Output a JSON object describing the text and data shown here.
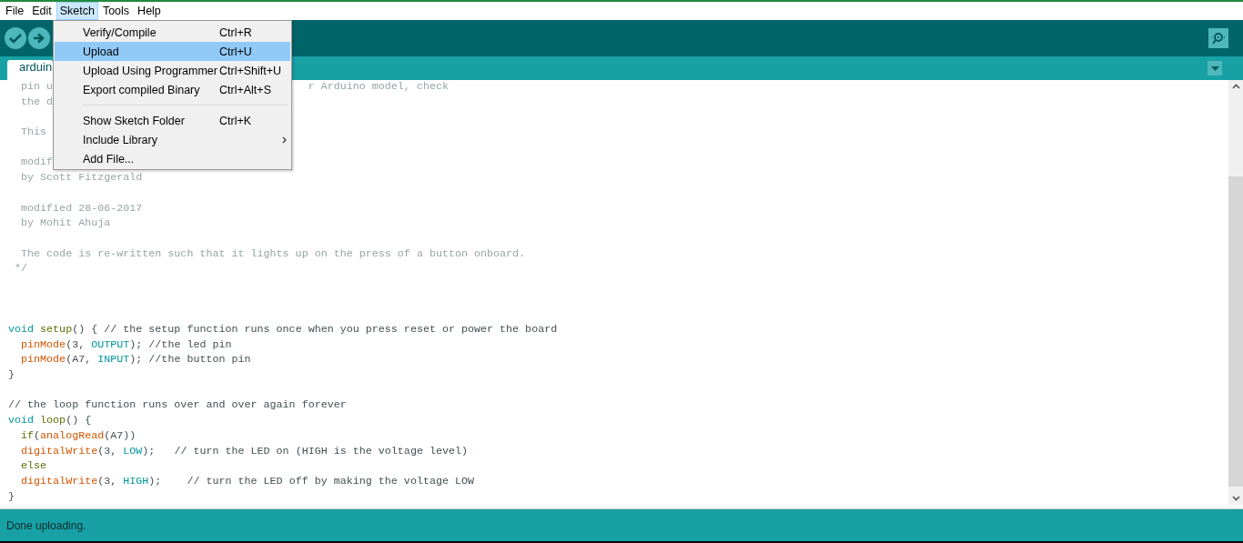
{
  "menu_bar": [
    {
      "label": "File",
      "selected": false
    },
    {
      "label": "Edit",
      "selected": false
    },
    {
      "label": "Sketch",
      "selected": true
    },
    {
      "label": "Tools",
      "selected": false
    },
    {
      "label": "Help",
      "selected": false
    }
  ],
  "toolbar": {
    "buttons": [
      {
        "kind": "verify"
      },
      {
        "kind": "upload"
      }
    ],
    "right_buttons": [
      {
        "kind": "serial-monitor"
      }
    ]
  },
  "tabs": [
    {
      "label": "arduin",
      "selected": true
    }
  ],
  "editor": {
    "lines": [
      {
        "kind": "code",
        "segments": [
          [
            {
              "kind": "comment",
              "text": "  pin u"
            }
          ],
          [
            {
              "kind": "comment",
              "text": "                                        r Arduino model, check"
            }
          ]
        ]
      },
      {
        "kind": "code",
        "segments": [
          [
            {
              "kind": "comment",
              "text": "  the d"
            }
          ]
        ]
      },
      {
        "kind": "blank"
      },
      {
        "kind": "code",
        "segments": [
          [
            {
              "kind": "comment",
              "text": "  This"
            }
          ]
        ]
      },
      {
        "kind": "blank"
      },
      {
        "kind": "code",
        "segments": [
          [
            {
              "kind": "comment",
              "text": "  modif"
            }
          ]
        ]
      },
      {
        "kind": "code",
        "segments": [
          [
            {
              "kind": "comment",
              "text": "  by Scott Fitzgerald"
            }
          ]
        ]
      },
      {
        "kind": "blank"
      },
      {
        "kind": "code",
        "segments": [
          [
            {
              "kind": "comment",
              "text": "  modified 28-06-2017"
            }
          ]
        ]
      },
      {
        "kind": "code",
        "segments": [
          [
            {
              "kind": "comment",
              "text": "  by Mohit Ahuja"
            }
          ]
        ]
      },
      {
        "kind": "blank"
      },
      {
        "kind": "code",
        "segments": [
          [
            {
              "kind": "comment",
              "text": "  The code is re-written such that it lights up on the press of a button onboard."
            }
          ]
        ]
      },
      {
        "kind": "code",
        "segments": [
          [
            {
              "kind": "comment",
              "text": " */"
            }
          ]
        ]
      },
      {
        "kind": "blank"
      },
      {
        "kind": "blank"
      },
      {
        "kind": "blank"
      },
      {
        "kind": "code",
        "segments": [
          [
            {
              "kind": "type",
              "text": "void "
            },
            {
              "kind": "function",
              "text": "setup"
            },
            {
              "kind": "plain",
              "text": "() { // the setup function runs once when you press reset or power the board"
            }
          ]
        ]
      },
      {
        "kind": "code",
        "segments": [
          [
            {
              "kind": "builtin",
              "text": "  pinMode"
            },
            {
              "kind": "plain",
              "text": "(3, "
            },
            {
              "kind": "constant",
              "text": "OUTPUT"
            },
            {
              "kind": "plain",
              "text": "); //the led pin"
            }
          ]
        ]
      },
      {
        "kind": "code",
        "segments": [
          [
            {
              "kind": "builtin",
              "text": "  pinMode"
            },
            {
              "kind": "plain",
              "text": "(A7, "
            },
            {
              "kind": "constant",
              "text": "INPUT"
            },
            {
              "kind": "plain",
              "text": "); //the button pin"
            }
          ]
        ]
      },
      {
        "kind": "code",
        "segments": [
          [
            {
              "kind": "plain",
              "text": "}"
            }
          ]
        ]
      },
      {
        "kind": "blank"
      },
      {
        "kind": "code",
        "segments": [
          [
            {
              "kind": "plain",
              "text": "// the loop function runs over and over again forever"
            }
          ]
        ]
      },
      {
        "kind": "code",
        "segments": [
          [
            {
              "kind": "type",
              "text": "void "
            },
            {
              "kind": "function",
              "text": "loop"
            },
            {
              "kind": "plain",
              "text": "() {"
            }
          ]
        ]
      },
      {
        "kind": "code",
        "segments": [
          [
            {
              "kind": "function",
              "text": "  if"
            },
            {
              "kind": "plain",
              "text": "("
            },
            {
              "kind": "builtin",
              "text": "analogRead"
            },
            {
              "kind": "plain",
              "text": "(A7))"
            }
          ]
        ]
      },
      {
        "kind": "code",
        "segments": [
          [
            {
              "kind": "builtin",
              "text": "  digitalWrite"
            },
            {
              "kind": "plain",
              "text": "(3, "
            },
            {
              "kind": "constant",
              "text": "LOW"
            },
            {
              "kind": "plain",
              "text": ");   // turn the LED on (HIGH is the voltage level)"
            }
          ]
        ]
      },
      {
        "kind": "code",
        "segments": [
          [
            {
              "kind": "function",
              "text": "  else"
            }
          ]
        ]
      },
      {
        "kind": "code",
        "segments": [
          [
            {
              "kind": "builtin",
              "text": "  digitalWrite"
            },
            {
              "kind": "plain",
              "text": "(3, "
            },
            {
              "kind": "constant",
              "text": "HIGH"
            },
            {
              "kind": "plain",
              "text": ");    // turn the LED off by making the voltage LOW"
            }
          ]
        ]
      },
      {
        "kind": "code",
        "segments": [
          [
            {
              "kind": "plain",
              "text": "}"
            }
          ]
        ]
      }
    ]
  },
  "dropdown_menu": {
    "items": [
      {
        "kind": "item",
        "label": "Verify/Compile",
        "shortcut": "Ctrl+R",
        "selected": false
      },
      {
        "kind": "item",
        "label": "Upload",
        "shortcut": "Ctrl+U",
        "selected": true
      },
      {
        "kind": "item",
        "label": "Upload Using Programmer",
        "shortcut": "Ctrl+Shift+U",
        "selected": false
      },
      {
        "kind": "item",
        "label": "Export compiled Binary",
        "shortcut": "Ctrl+Alt+S",
        "selected": false
      },
      {
        "kind": "separator"
      },
      {
        "kind": "item",
        "label": "Show Sketch Folder",
        "shortcut": "Ctrl+K",
        "selected": false
      },
      {
        "kind": "submenu",
        "label": "Include Library",
        "selected": false
      },
      {
        "kind": "item",
        "label": "Add File...",
        "selected": false
      }
    ]
  },
  "status_bar": {
    "message": "Done uploading."
  }
}
